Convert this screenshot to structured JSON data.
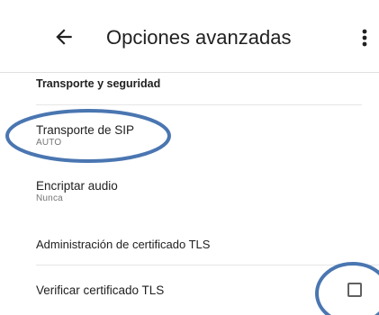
{
  "appbar": {
    "title": "Opciones avanzadas",
    "back_icon": "arrow-left-icon",
    "overflow_icon": "more-vert-icon"
  },
  "sections": [
    {
      "header": "Transporte y seguridad",
      "items": [
        {
          "title": "Transporte de SIP",
          "subtitle": "AUTO"
        },
        {
          "title": "Encriptar audio",
          "subtitle": "Nunca"
        }
      ]
    },
    {
      "header": "Administración de certificado TLS",
      "items": [
        {
          "title": "Verificar certificado TLS",
          "checked": false
        }
      ]
    }
  ],
  "colors": {
    "text_primary": "#212121",
    "text_secondary": "#757575",
    "annotation_blue": "#4a76b1"
  }
}
